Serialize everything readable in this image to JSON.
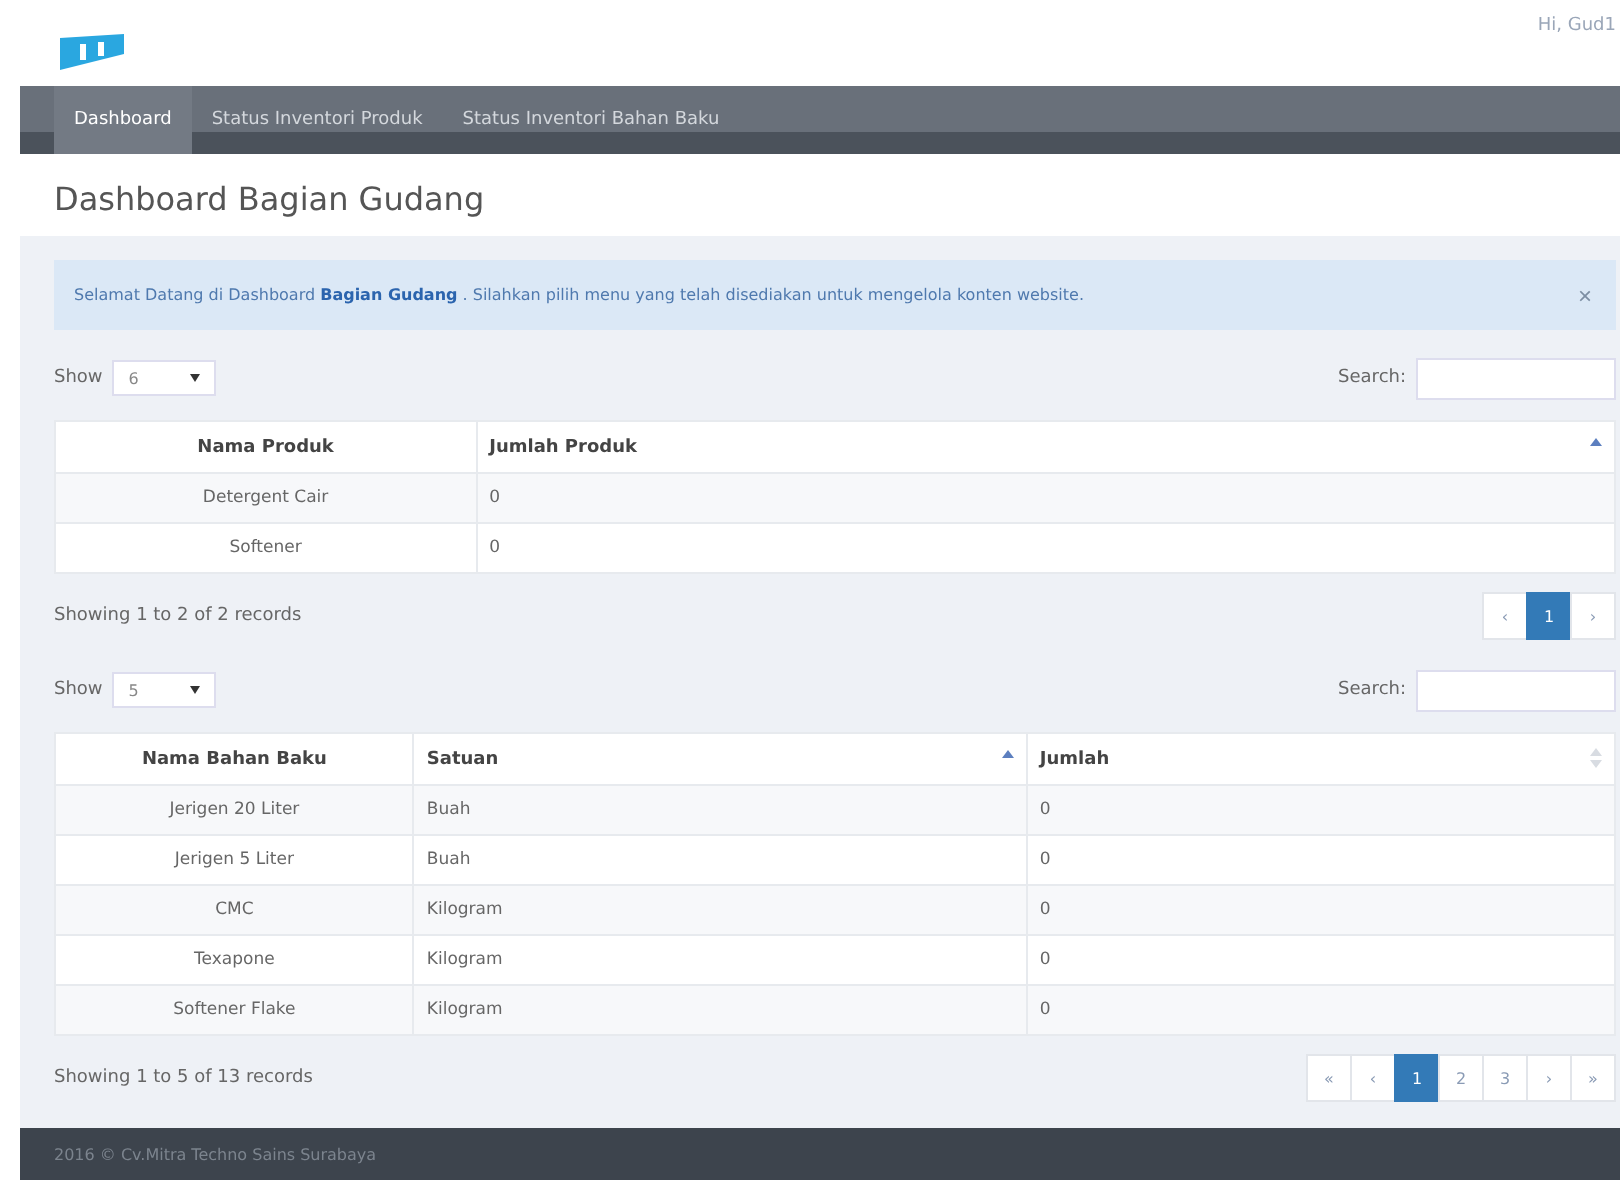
{
  "header": {
    "greeting": "Hi, Gud1"
  },
  "nav": [
    {
      "label": "Dashboard",
      "selected": true
    },
    {
      "label": "Status Inventori Produk",
      "selected": false
    },
    {
      "label": "Status Inventori Bahan Baku",
      "selected": false
    }
  ],
  "page_title": "Dashboard Bagian Gudang",
  "alert": {
    "text": "Selamat Datang di Dashboard **Bagian Gudang** . Silahkan pilih menu yang telah disediakan untuk mengelola konten website.",
    "close": "×"
  },
  "tables": [
    {
      "show_label": "Show",
      "page_size": "6",
      "search_label": "Search:",
      "columns": [
        {
          "label": "Nama Produk",
          "kind": "plain"
        },
        {
          "label": "Jumlah Produk",
          "kind": "sorted"
        }
      ],
      "rows": [
        [
          "Detergent Cair",
          "0"
        ],
        [
          "Softener",
          "0"
        ]
      ],
      "info": "Showing 1 to 2 of 2 records",
      "pagination": [
        {
          "label": "‹",
          "selected": false
        },
        {
          "label": "1",
          "selected": true
        },
        {
          "label": "›",
          "selected": false
        }
      ]
    },
    {
      "show_label": "Show",
      "page_size": "5",
      "search_label": "Search:",
      "columns": [
        {
          "label": "Nama Bahan Baku",
          "kind": "plain"
        },
        {
          "label": "Satuan",
          "kind": "sorted"
        },
        {
          "label": "Jumlah",
          "kind": "sortable"
        }
      ],
      "rows": [
        [
          "Jerigen 20 Liter",
          "Buah",
          "0"
        ],
        [
          "Jerigen 5 Liter",
          "Buah",
          "0"
        ],
        [
          "CMC",
          "Kilogram",
          "0"
        ],
        [
          "Texapone",
          "Kilogram",
          "0"
        ],
        [
          "Softener Flake",
          "Kilogram",
          "0"
        ]
      ],
      "info": "Showing 1 to 5 of 13 records",
      "pagination": [
        {
          "label": "«",
          "selected": false
        },
        {
          "label": "‹",
          "selected": false
        },
        {
          "label": "1",
          "selected": true
        },
        {
          "label": "2",
          "selected": false
        },
        {
          "label": "3",
          "selected": false
        },
        {
          "label": "›",
          "selected": false
        },
        {
          "label": "»",
          "selected": false
        }
      ]
    }
  ],
  "footer": "2016 © Cv.Mitra Techno Sains Surabaya"
}
